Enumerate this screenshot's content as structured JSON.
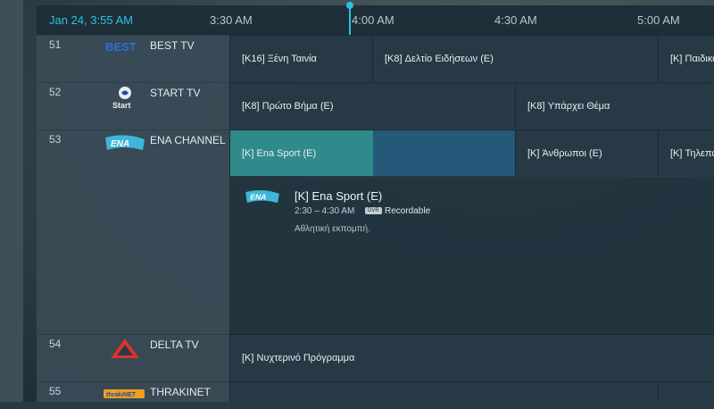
{
  "header": {
    "date_time": "Jan 24, 3:55 AM",
    "times": [
      "3:30 AM",
      "4:00 AM",
      "4:30 AM",
      "5:00 AM"
    ]
  },
  "channels": [
    {
      "number": "51",
      "name": "BEST TV",
      "logo": "best-tv-logo",
      "logo_text": "BEST"
    },
    {
      "number": "52",
      "name": "START TV",
      "logo": "start-tv-logo",
      "logo_text": "Start"
    },
    {
      "number": "53",
      "name": "ENA CHANNEL",
      "logo": "ena-channel-logo",
      "logo_text": "ENA"
    },
    {
      "number": "54",
      "name": "DELTA TV",
      "logo": "delta-tv-logo",
      "logo_text": ""
    },
    {
      "number": "55",
      "name": "THRAKINET",
      "logo": "thrakinet-logo",
      "logo_text": "thrakiNET"
    }
  ],
  "programs": {
    "row51": [
      "[K16] Ξένη Ταινία",
      "[K8] Δελτίο Ειδήσεων (E)",
      "[K] Παιδικό"
    ],
    "row52": [
      "[K8] Πρώτο Βήμα (E)",
      "[K8] Υπάρχει Θέμα"
    ],
    "row53": [
      "[K] Ena Sport (E)",
      "[K] Άνθρωποι (E)",
      "[K] Τηλεπω"
    ],
    "row54": [
      "[K] Νυχτερινό Πρόγραμμα"
    ]
  },
  "selected_program": {
    "title": "[K] Ena Sport (E)",
    "time": "2:30 – 4:30 AM",
    "dvr_badge": "DVR",
    "recordable": "Recordable",
    "description": "Αθλητική εκπομπή.",
    "progress": 0.5
  },
  "colors": {
    "accent": "#29c3e0",
    "selected": "#24597a",
    "progress": "#2f8a8c"
  }
}
